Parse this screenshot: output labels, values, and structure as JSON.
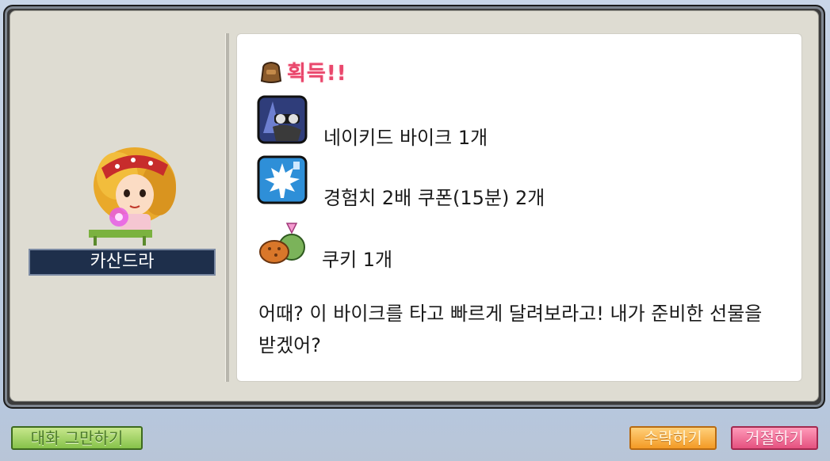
{
  "npc": {
    "name": "카산드라"
  },
  "dialog": {
    "header": "획득!!",
    "rewards": [
      {
        "label": "네이키드 바이크 1개",
        "icon": "bike-icon"
      },
      {
        "label": "경험치 2배 쿠폰(15분) 2개",
        "icon": "maple-leaf-coupon-icon"
      },
      {
        "label": "쿠키 1개",
        "icon": "cookie-bag-icon"
      }
    ],
    "message": "어때? 이 바이크를 타고 빠르게 달려보라고! 내가 준비한 선물을 받겠어?"
  },
  "buttons": {
    "end_chat": "대화 그만하기",
    "accept": "수락하기",
    "decline": "거절하기"
  },
  "colors": {
    "header": "#e9476c",
    "name_plate": "#1e2f4b",
    "accept": "#f39a25",
    "decline": "#e5517f",
    "end_chat": "#86c24a"
  }
}
